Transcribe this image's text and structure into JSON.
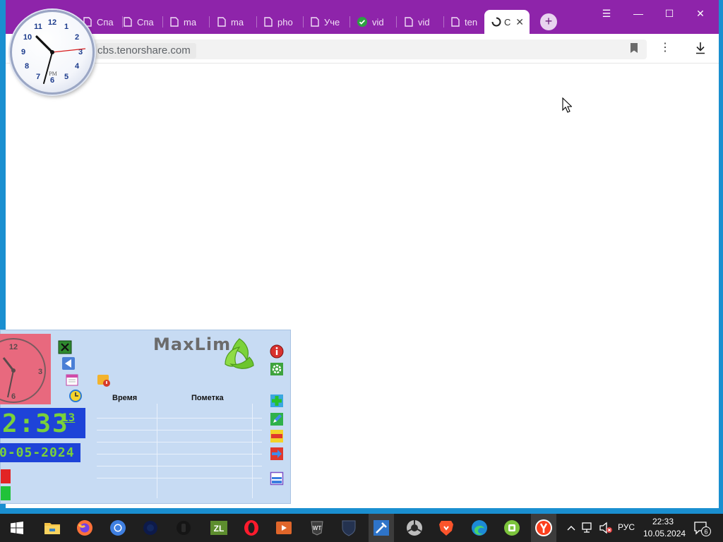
{
  "browser": {
    "tabs": [
      {
        "label": "Спа",
        "icon": "page-icon"
      },
      {
        "label": "Спа",
        "icon": "page-icon"
      },
      {
        "label": "ma",
        "icon": "page-icon"
      },
      {
        "label": "ma",
        "icon": "page-icon"
      },
      {
        "label": "pho",
        "icon": "page-icon"
      },
      {
        "label": "Уче",
        "icon": "page-icon"
      },
      {
        "label": "vid",
        "icon": "check-circle-icon"
      },
      {
        "label": "vid",
        "icon": "page-icon"
      },
      {
        "label": "ten",
        "icon": "page-icon"
      }
    ],
    "active_tab": {
      "label": "С",
      "icon": "loading-spinner-icon",
      "close": "✕"
    },
    "new_tab": "+",
    "window_controls": {
      "menu": "☰",
      "minimize": "—",
      "maximize": "☐",
      "close": "✕"
    },
    "url": "cbs.tenorshare.com",
    "accent_color": "#8e24aa"
  },
  "clock_gadget": {
    "numbers": [
      "12",
      "1",
      "2",
      "3",
      "4",
      "5",
      "6",
      "7",
      "8",
      "9",
      "10",
      "11"
    ],
    "ampm": "PM"
  },
  "maxlim": {
    "title": "MaxLim",
    "analog_numbers": [
      "12",
      "3",
      "6"
    ],
    "time_hm": "2:33",
    "time_sec": "13",
    "date": "0-05-2024",
    "columns": [
      "Время",
      "Пометка"
    ]
  },
  "taskbar": {
    "apps": [
      "windows-start-icon",
      "file-explorer-icon",
      "firefox-icon",
      "chromium-icon",
      "dark-app-icon",
      "dark-app-icon",
      "zennolab-icon",
      "opera-icon",
      "media-player-icon",
      "world-of-tanks-icon",
      "shield-app-icon",
      "tool-app-icon",
      "chrome-dev-icon",
      "brave-icon",
      "edge-icon",
      "green-app-icon",
      "yandex-browser-icon"
    ],
    "tray": {
      "lang": "РУС",
      "time": "22:33",
      "date": "10.05.2024",
      "notifications": "6"
    }
  }
}
